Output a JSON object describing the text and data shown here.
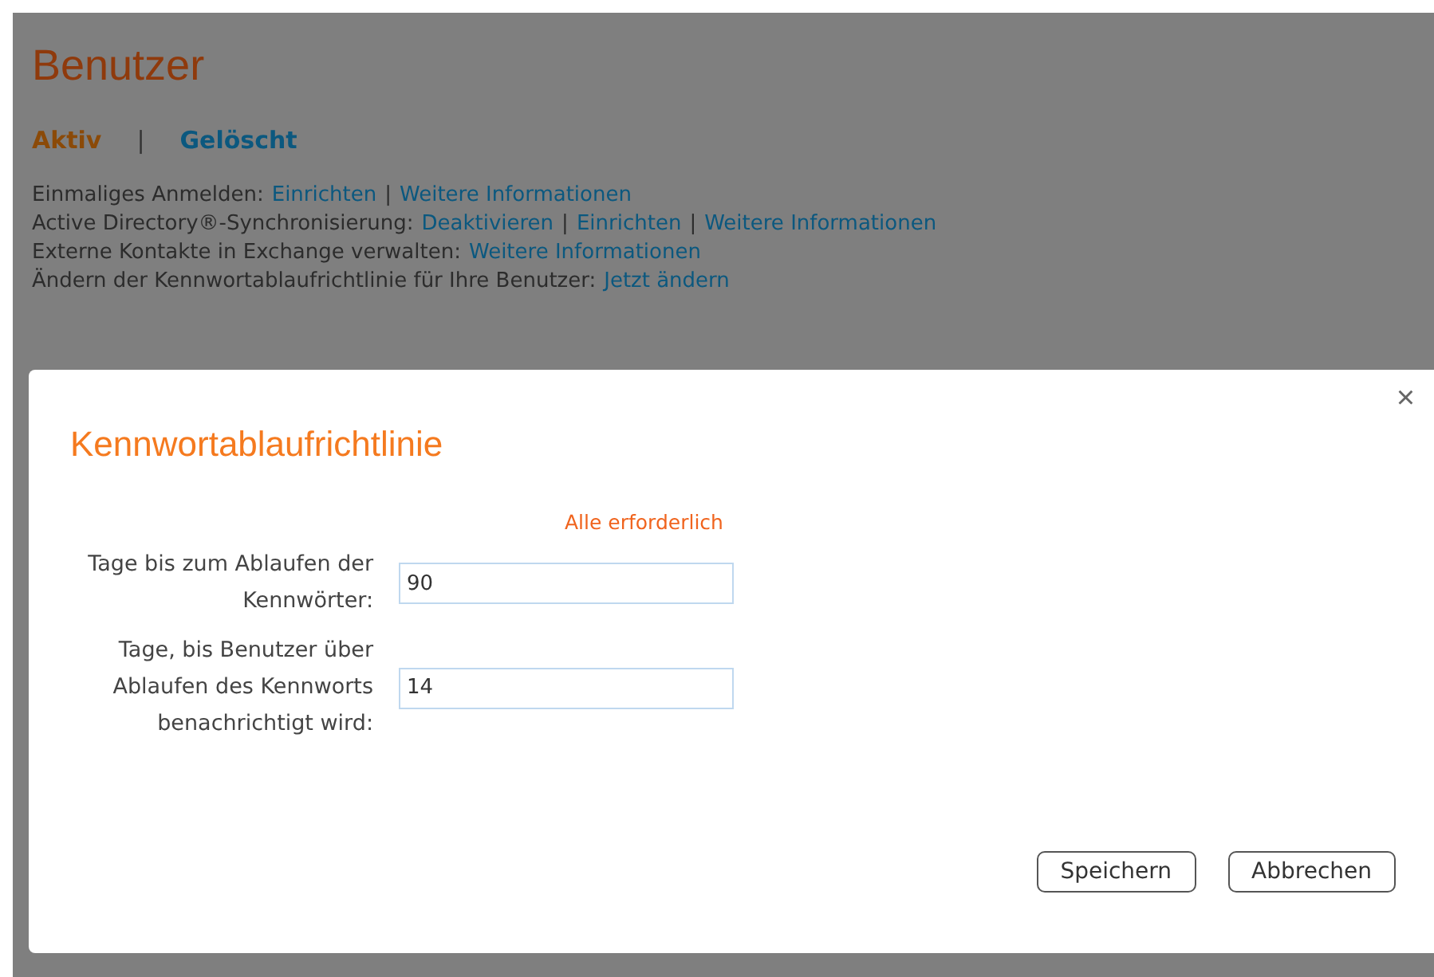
{
  "page": {
    "title": "Benutzer",
    "tabs": [
      {
        "label": "Aktiv",
        "selected": true
      },
      {
        "label": "Gelöscht",
        "selected": false
      }
    ],
    "tab_separator": "|",
    "info_lines": [
      {
        "parts": [
          {
            "kind": "text",
            "text": "Einmaliges Anmelden:"
          },
          {
            "kind": "link",
            "text": "Einrichten"
          },
          {
            "kind": "sep",
            "text": "|"
          },
          {
            "kind": "link",
            "text": "Weitere Informationen"
          }
        ]
      },
      {
        "parts": [
          {
            "kind": "text",
            "text": "Active Directory®-Synchronisierung:"
          },
          {
            "kind": "link",
            "text": "Deaktivieren"
          },
          {
            "kind": "sep",
            "text": "|"
          },
          {
            "kind": "link",
            "text": "Einrichten"
          },
          {
            "kind": "sep",
            "text": "|"
          },
          {
            "kind": "link",
            "text": "Weitere Informationen"
          }
        ]
      },
      {
        "parts": [
          {
            "kind": "text",
            "text": "Externe Kontakte in Exchange verwalten:"
          },
          {
            "kind": "link",
            "text": "Weitere Informationen"
          }
        ]
      },
      {
        "parts": [
          {
            "kind": "text",
            "text": "Ändern der Kennwortablaufrichtlinie für Ihre Benutzer:"
          },
          {
            "kind": "link",
            "text": "Jetzt ändern"
          }
        ]
      }
    ]
  },
  "dialog": {
    "title": "Kennwortablaufrichtlinie",
    "close": "×",
    "required_note": "Alle erforderlich",
    "fields": [
      {
        "label": "Tage bis zum Ablaufen der Kennwörter:",
        "value": "90"
      },
      {
        "label": "Tage, bis Benutzer über Ablaufen des Kennworts benachrichtigt wird:",
        "value": "14"
      }
    ],
    "buttons": [
      "Speichern",
      "Abbrechen"
    ]
  }
}
